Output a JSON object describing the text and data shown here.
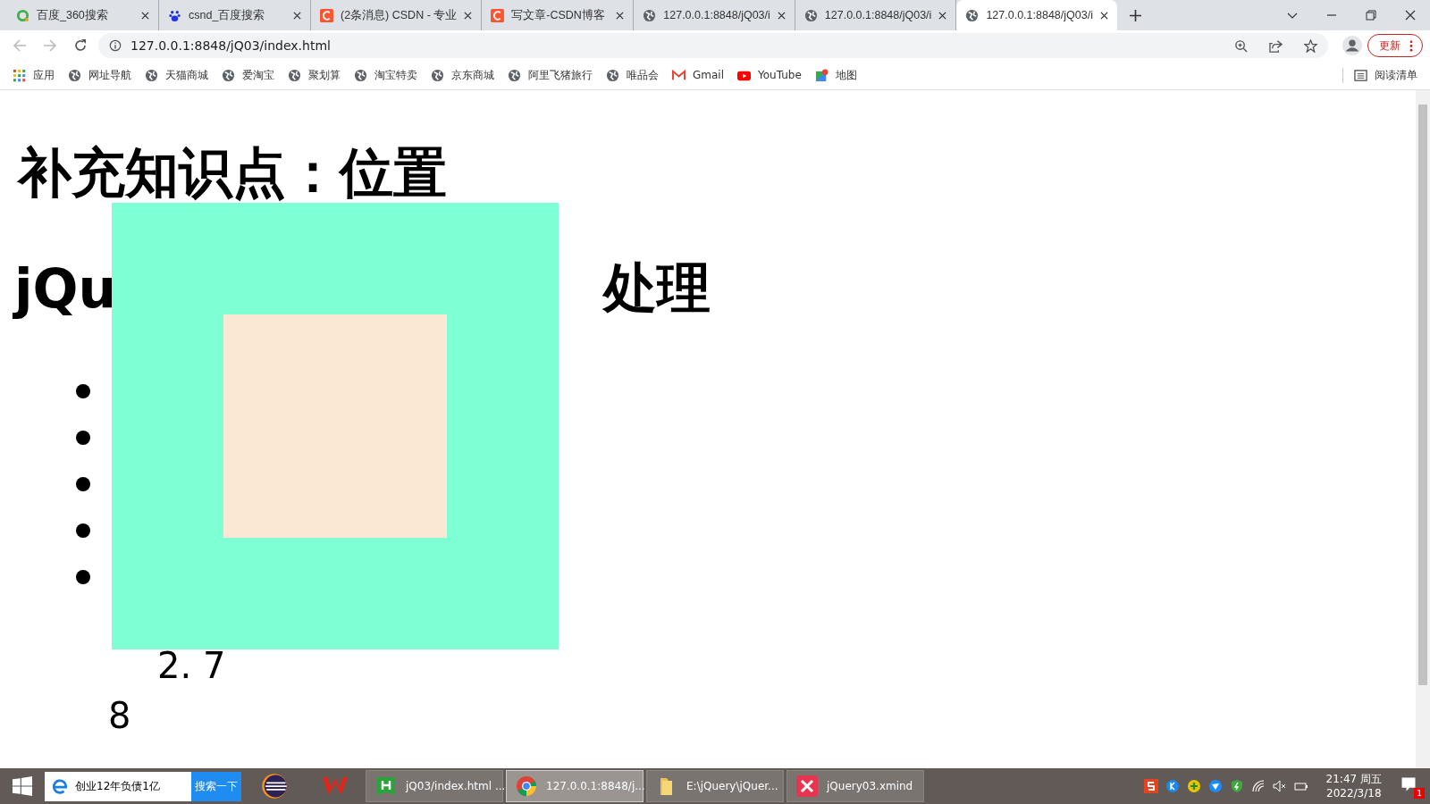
{
  "browser": {
    "tabs": [
      {
        "title": "百度_360搜索",
        "kind": "ring",
        "selected": false
      },
      {
        "title": "csnd_百度搜索",
        "kind": "paw",
        "selected": false
      },
      {
        "title": "(2条消息) CSDN - 专业",
        "kind": "csdn",
        "selected": false
      },
      {
        "title": "写文章-CSDN博客",
        "kind": "csdn",
        "selected": false
      },
      {
        "title": "127.0.0.1:8848/jQ03/i",
        "kind": "globe",
        "selected": false
      },
      {
        "title": "127.0.0.1:8848/jQ03/i",
        "kind": "globe",
        "selected": false
      },
      {
        "title": "127.0.0.1:8848/jQ03/i",
        "kind": "globe",
        "selected": true
      }
    ],
    "address": "127.0.0.1:8848/jQ03/index.html",
    "update_button": "更新",
    "bookmarks": [
      {
        "label": "应用",
        "kind": "apps"
      },
      {
        "label": "网址导航",
        "kind": "globe"
      },
      {
        "label": "天猫商城",
        "kind": "globe"
      },
      {
        "label": "爱淘宝",
        "kind": "globe"
      },
      {
        "label": "聚划算",
        "kind": "globe"
      },
      {
        "label": "淘宝特卖",
        "kind": "globe"
      },
      {
        "label": "京东商城",
        "kind": "globe"
      },
      {
        "label": "阿里飞猪旅行",
        "kind": "globe"
      },
      {
        "label": "唯品会",
        "kind": "globe"
      },
      {
        "label": "Gmail",
        "kind": "gmail"
      },
      {
        "label": "YouTube",
        "kind": "youtube"
      },
      {
        "label": "地图",
        "kind": "maps"
      }
    ],
    "reading_list": "阅读清单"
  },
  "page": {
    "title": "补充知识点：位置",
    "heading_left": "jQu",
    "heading_right": "处理",
    "line_1": "2. 7",
    "line_2": "8"
  },
  "taskbar": {
    "search_value": "创业12年负债1亿",
    "search_button": "搜索一下",
    "windows": [
      {
        "title": "jQ03/index.html ...",
        "kind": "hbuilder",
        "selected": false
      },
      {
        "title": "127.0.0.1:8848/j...",
        "kind": "chrome",
        "selected": true
      },
      {
        "title": "E:\\jQuery\\jQuer...",
        "kind": "folder",
        "selected": false
      },
      {
        "title": "jQuery03.xmind",
        "kind": "xmind",
        "selected": false
      }
    ],
    "time": "21:47 周五",
    "date": "2022/3/18",
    "notification_count": "1"
  }
}
